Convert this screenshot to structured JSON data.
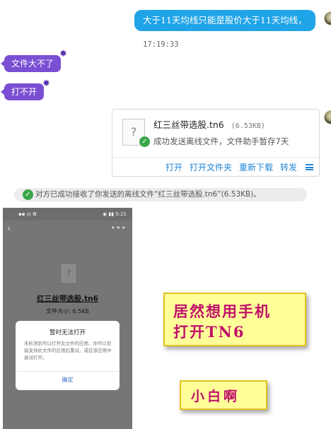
{
  "chat": {
    "outgoing_message": "大于11天均线只能是股价大于11天均线，",
    "timestamp": "17:19:33",
    "incoming_messages": [
      "文件大不了",
      "打不开"
    ]
  },
  "file_card": {
    "file_name": "红三丝带选股.tn6",
    "file_size": "(6.53KB)",
    "status": "成功发送离线文件，文件助手暂存7天",
    "actions": [
      "打开",
      "打开文件夹",
      "重新下载",
      "转发"
    ],
    "icon": "question-file-icon"
  },
  "system_notice": "对方已成功接收了你发送的离线文件“红三丝带选股.tn6”(6.53KB)。",
  "phone_screenshot": {
    "status_left": "▪▪ ◎ ✿",
    "status_right": "◉ ▮▮ 5:21",
    "more_icon": "•••",
    "file_name": "红三丝带选股.tn6",
    "file_size": "文件大小: 6.5KB",
    "dialog": {
      "title": "暂时无法打开",
      "message": "未检测到可以打开此文件的应用。你可以安装支持此文件的应用后重试，或在该应用中尝试打开。",
      "button": "确定"
    }
  },
  "captions": {
    "line1": "居然想用手机",
    "line2": "打开TN6",
    "second": "小白啊"
  },
  "colors": {
    "outgoing_bubble": "#1fa4e8",
    "incoming_bubble": "#7a4fd3",
    "action_link": "#1f86d9",
    "caption_bg": "#ffff99",
    "caption_text": "#c0106a"
  }
}
